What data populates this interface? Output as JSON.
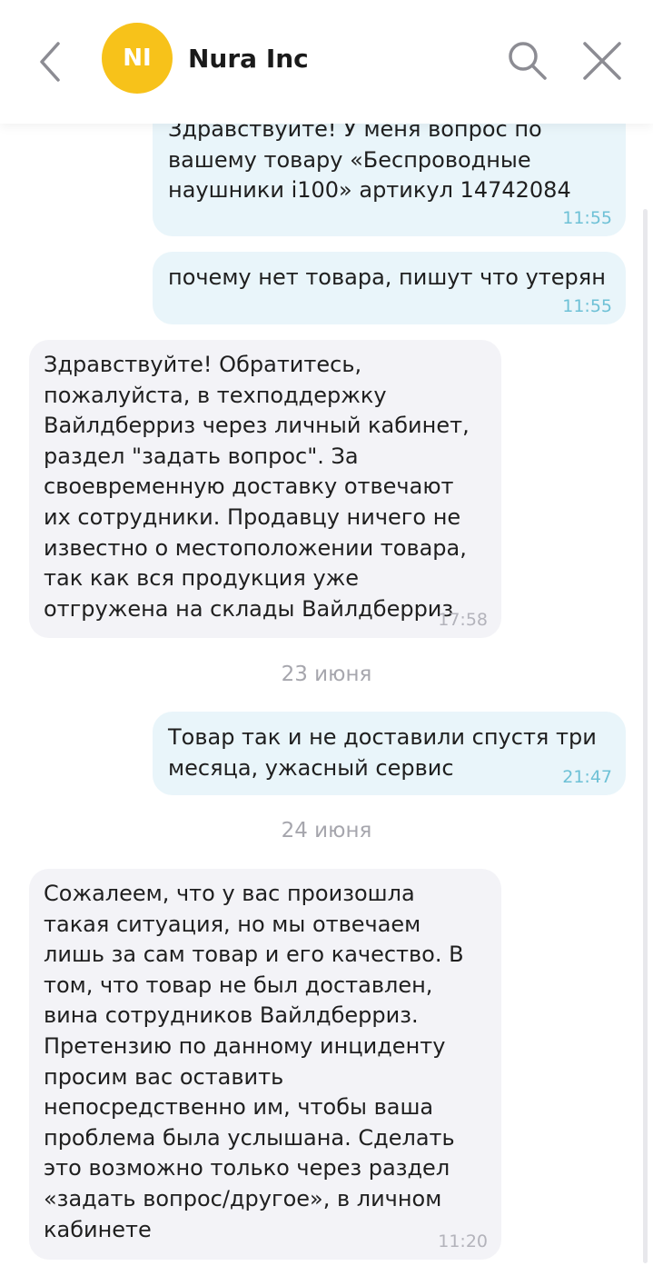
{
  "header": {
    "avatar_initials": "NI",
    "title": "Nura Inc",
    "avatar_color": "#f7c21a",
    "icons": {
      "back": "chevron-left-icon",
      "search": "search-icon",
      "close": "close-icon"
    }
  },
  "messages": [
    {
      "direction": "out",
      "text": "Здравствуйте! У меня вопрос по вашему товару «Беспроводные наушники i100» артикул 14742084",
      "time": "11:55"
    },
    {
      "direction": "out",
      "text": "почему нет товара, пишут что утерян",
      "time": "11:55"
    },
    {
      "direction": "in",
      "text": "Здравствуйте! Обратитесь, пожалуйста, в техподдержку Вайлдберриз через личный кабинет, раздел \"задать вопрос\". За своевременную доставку отвечают их сотрудники. Продавцу ничего не известно о местоположении товара, так как вся продукция уже отгружена на склады Вайлдберриз",
      "time": "17:58"
    },
    {
      "date_separator": "23 июня"
    },
    {
      "direction": "out",
      "text": "Товар так и не доставили спустя три месяца, ужасный сервис",
      "time": "21:47"
    },
    {
      "date_separator": "24 июня"
    },
    {
      "direction": "in",
      "text": "Сожалеем, что у вас произошла такая ситуация, но мы отвечаем лишь за сам товар и его качество. В том, что товар не был доставлен, вина сотрудников Вайлдберриз. Претензию по данному инциденту просим вас оставить непосредственно им, чтобы ваша проблема была услышана. Сделать это возможно только через раздел «задать вопрос/другое», в личном кабинете",
      "time": "11:20"
    }
  ],
  "colors": {
    "outgoing_bubble": "#e9f5fa",
    "incoming_bubble": "#f3f3f7",
    "outgoing_time": "#6ec1d6",
    "incoming_time": "#b3b3bb"
  }
}
